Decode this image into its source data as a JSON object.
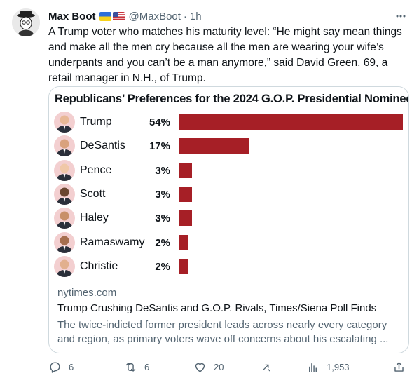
{
  "tweet": {
    "author_name": "Max Boot",
    "handle": "@MaxBoot",
    "separator": "·",
    "time": "1h",
    "text": "A Trump voter who matches his maturity level: “He might say mean things\nand make all the men cry because all the men are wearing your wife’s\nunderpants and you can’t be a man anymore,” said David Green, 69, a\nretail manager in N.H., of Trump.",
    "more_icon": "more-horizontal-icon",
    "flags": [
      "ukraine-flag-icon",
      "us-flag-icon"
    ]
  },
  "card": {
    "source": "nytimes.com",
    "headline": "Trump Crushing DeSantis and G.O.P. Rivals, Times/Siena Poll Finds",
    "description": "The twice-indicted former president leads across nearly every category and region, as primary voters wave off concerns about his escalating ..."
  },
  "chart_data": {
    "type": "bar",
    "orientation": "horizontal",
    "title": "Republicans’ Preferences for the 2024 G.O.P. Presidential Nominee",
    "categories": [
      "Trump",
      "DeSantis",
      "Pence",
      "Scott",
      "Haley",
      "Ramaswamy",
      "Christie"
    ],
    "values": [
      54,
      17,
      3,
      3,
      3,
      2,
      2
    ],
    "value_labels": [
      "54%",
      "17%",
      "3%",
      "3%",
      "3%",
      "2%",
      "2%"
    ],
    "unit": "%",
    "xlim": [
      0,
      54
    ],
    "bar_color": "#a61f26",
    "grid": false
  },
  "actions": {
    "replies": "6",
    "retweets": "6",
    "likes": "20",
    "views": "1,953"
  },
  "colors": {
    "text": "#0f1419",
    "muted": "#536471",
    "border": "#cfd9de",
    "bar": "#a61f26",
    "portrait_bg": "#f3cfd0"
  }
}
